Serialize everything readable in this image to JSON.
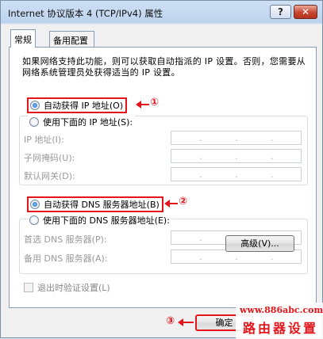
{
  "window": {
    "title": "Internet 协议版本 4 (TCP/IPv4) 属性",
    "help_label": "?",
    "close_label": "✕"
  },
  "tabs": [
    {
      "label": "常规",
      "active": true
    },
    {
      "label": "备用配置",
      "active": false
    }
  ],
  "description": "如果网络支持此功能，则可以获取自动指派的 IP 设置。否则，您需要从网络系统管理员处获得适当的 IP 设置。",
  "ip_section": {
    "auto_option": "自动获得 IP 地址(O)",
    "manual_option": "使用下面的 IP 地址(S):",
    "auto_selected": true,
    "fields": [
      {
        "label": "IP 地址(I):"
      },
      {
        "label": "子网掩码(U):"
      },
      {
        "label": "默认网关(D):"
      }
    ]
  },
  "dns_section": {
    "auto_option": "自动获得 DNS 服务器地址(B)",
    "manual_option": "使用下面的 DNS 服务器地址(E):",
    "auto_selected": true,
    "fields": [
      {
        "label": "首选 DNS 服务器(P):"
      },
      {
        "label": "备用 DNS 服务器(A):"
      }
    ]
  },
  "ip_dots": ".",
  "validate_checkbox": {
    "label": "退出时验证设置(L)",
    "checked": false
  },
  "advanced_button": "高级(V)...",
  "ok_button": "确定",
  "annotations": {
    "one": "①",
    "two": "②",
    "three": "③"
  },
  "watermark": {
    "url": "www.886abc.com",
    "brand": "路由器设置"
  },
  "colors": {
    "annotation": "#e3151a",
    "selected_radio": "#1b5fb8"
  }
}
